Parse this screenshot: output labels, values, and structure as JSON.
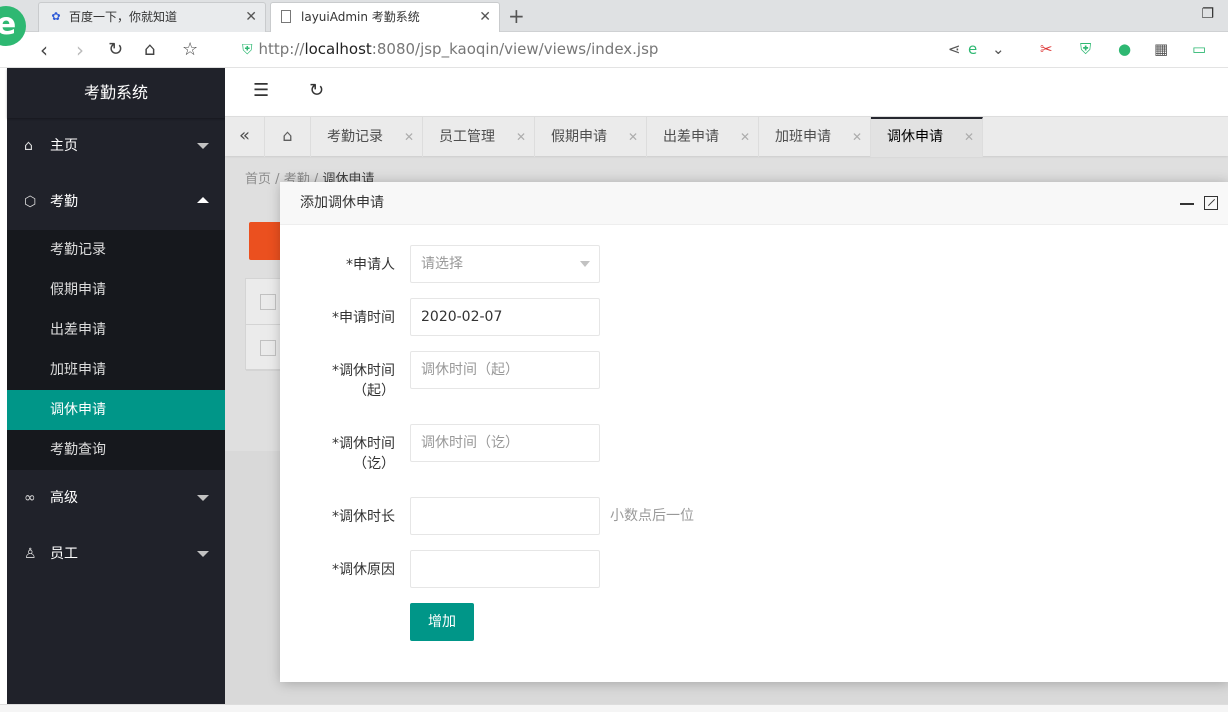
{
  "browser": {
    "tabs": [
      {
        "title": "百度一下，你就知道",
        "favicon": "baidu-icon"
      },
      {
        "title": "layuiAdmin 考勤系统",
        "favicon": "page-icon"
      }
    ],
    "new_tab": "+",
    "url": {
      "scheme": "http://",
      "host": "localhost",
      "rest": ":8080/jsp_kaoqin/view/views/index.jsp"
    }
  },
  "sidebar": {
    "title": "考勤系统",
    "items": [
      {
        "label": "主页",
        "icon": "home-icon"
      },
      {
        "label": "考勤",
        "icon": "cube-icon",
        "expanded": true,
        "children": [
          "考勤记录",
          "假期申请",
          "出差申请",
          "加班申请",
          "调休申请",
          "考勤查询"
        ],
        "active_child": "调休申请"
      },
      {
        "label": "高级",
        "icon": "infinity-icon"
      },
      {
        "label": "员工",
        "icon": "user-icon"
      }
    ]
  },
  "page_tabs": [
    "考勤记录",
    "员工管理",
    "假期申请",
    "出差申请",
    "加班申请",
    "调休申请"
  ],
  "active_page_tab": "调休申请",
  "breadcrumb": {
    "home": "首页",
    "sep": "/",
    "section": "考勤",
    "current": "调休申请"
  },
  "dialog": {
    "title": "添加调休申请",
    "fields": [
      {
        "label": "*申请人",
        "value": "",
        "placeholder": "请选择",
        "type": "select"
      },
      {
        "label": "*申请时间",
        "value": "2020-02-07",
        "placeholder": ""
      },
      {
        "label_line1": "*调休时间",
        "label_line2": "（起）",
        "value": "",
        "placeholder": "调休时间（起）"
      },
      {
        "label_line1": "*调休时间",
        "label_line2": "（讫）",
        "value": "",
        "placeholder": "调休时间（讫）"
      },
      {
        "label": "*调休时长",
        "value": "",
        "placeholder": "",
        "hint": "小数点后一位"
      },
      {
        "label": "*调休原因",
        "value": "",
        "placeholder": ""
      }
    ],
    "submit_label": "增加"
  },
  "colors": {
    "accent": "#009688",
    "sidebar_bg": "#20222a",
    "required": "#e00000"
  }
}
